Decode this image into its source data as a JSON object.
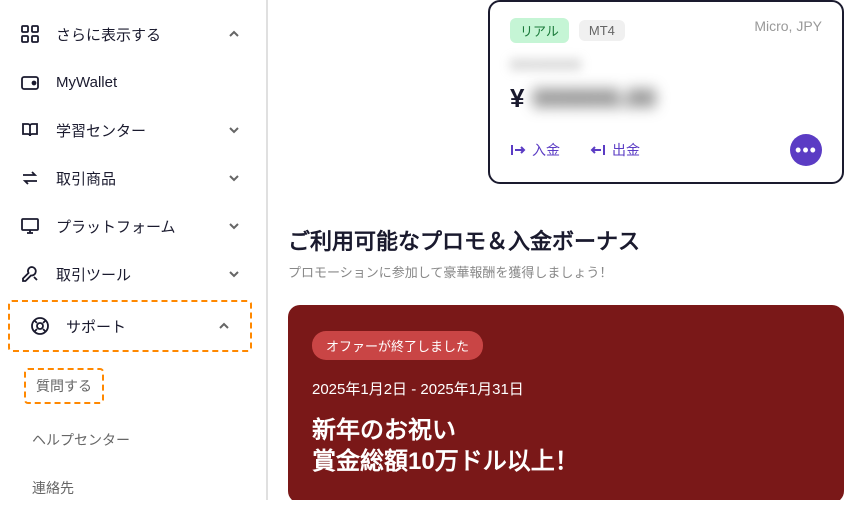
{
  "sidebar": {
    "items": [
      {
        "label": "さらに表示する"
      },
      {
        "label": "MyWallet"
      },
      {
        "label": "学習センター"
      },
      {
        "label": "取引商品"
      },
      {
        "label": "プラットフォーム"
      },
      {
        "label": "取引ツール"
      },
      {
        "label": "サポート"
      }
    ],
    "support_sub": [
      {
        "label": "質問する"
      },
      {
        "label": "ヘルプセンター"
      },
      {
        "label": "連絡先"
      }
    ]
  },
  "account": {
    "tag_real": "リアル",
    "tag_mt4": "MT4",
    "meta": "Micro, JPY",
    "blurred_id": "00000000",
    "currency": "¥",
    "blurred_amount": "000000.00",
    "deposit": "入金",
    "withdraw": "出金"
  },
  "promo": {
    "title": "ご利用可能なプロモ＆入金ボーナス",
    "subtitle": "プロモーションに参加して豪華報酬を獲得しましょう！",
    "badge": "オファーが終了しました",
    "dates": "2025年1月2日 - 2025年1月31日",
    "heading1": "新年のお祝い",
    "heading2": "賞金総額10万ドル以上！"
  }
}
